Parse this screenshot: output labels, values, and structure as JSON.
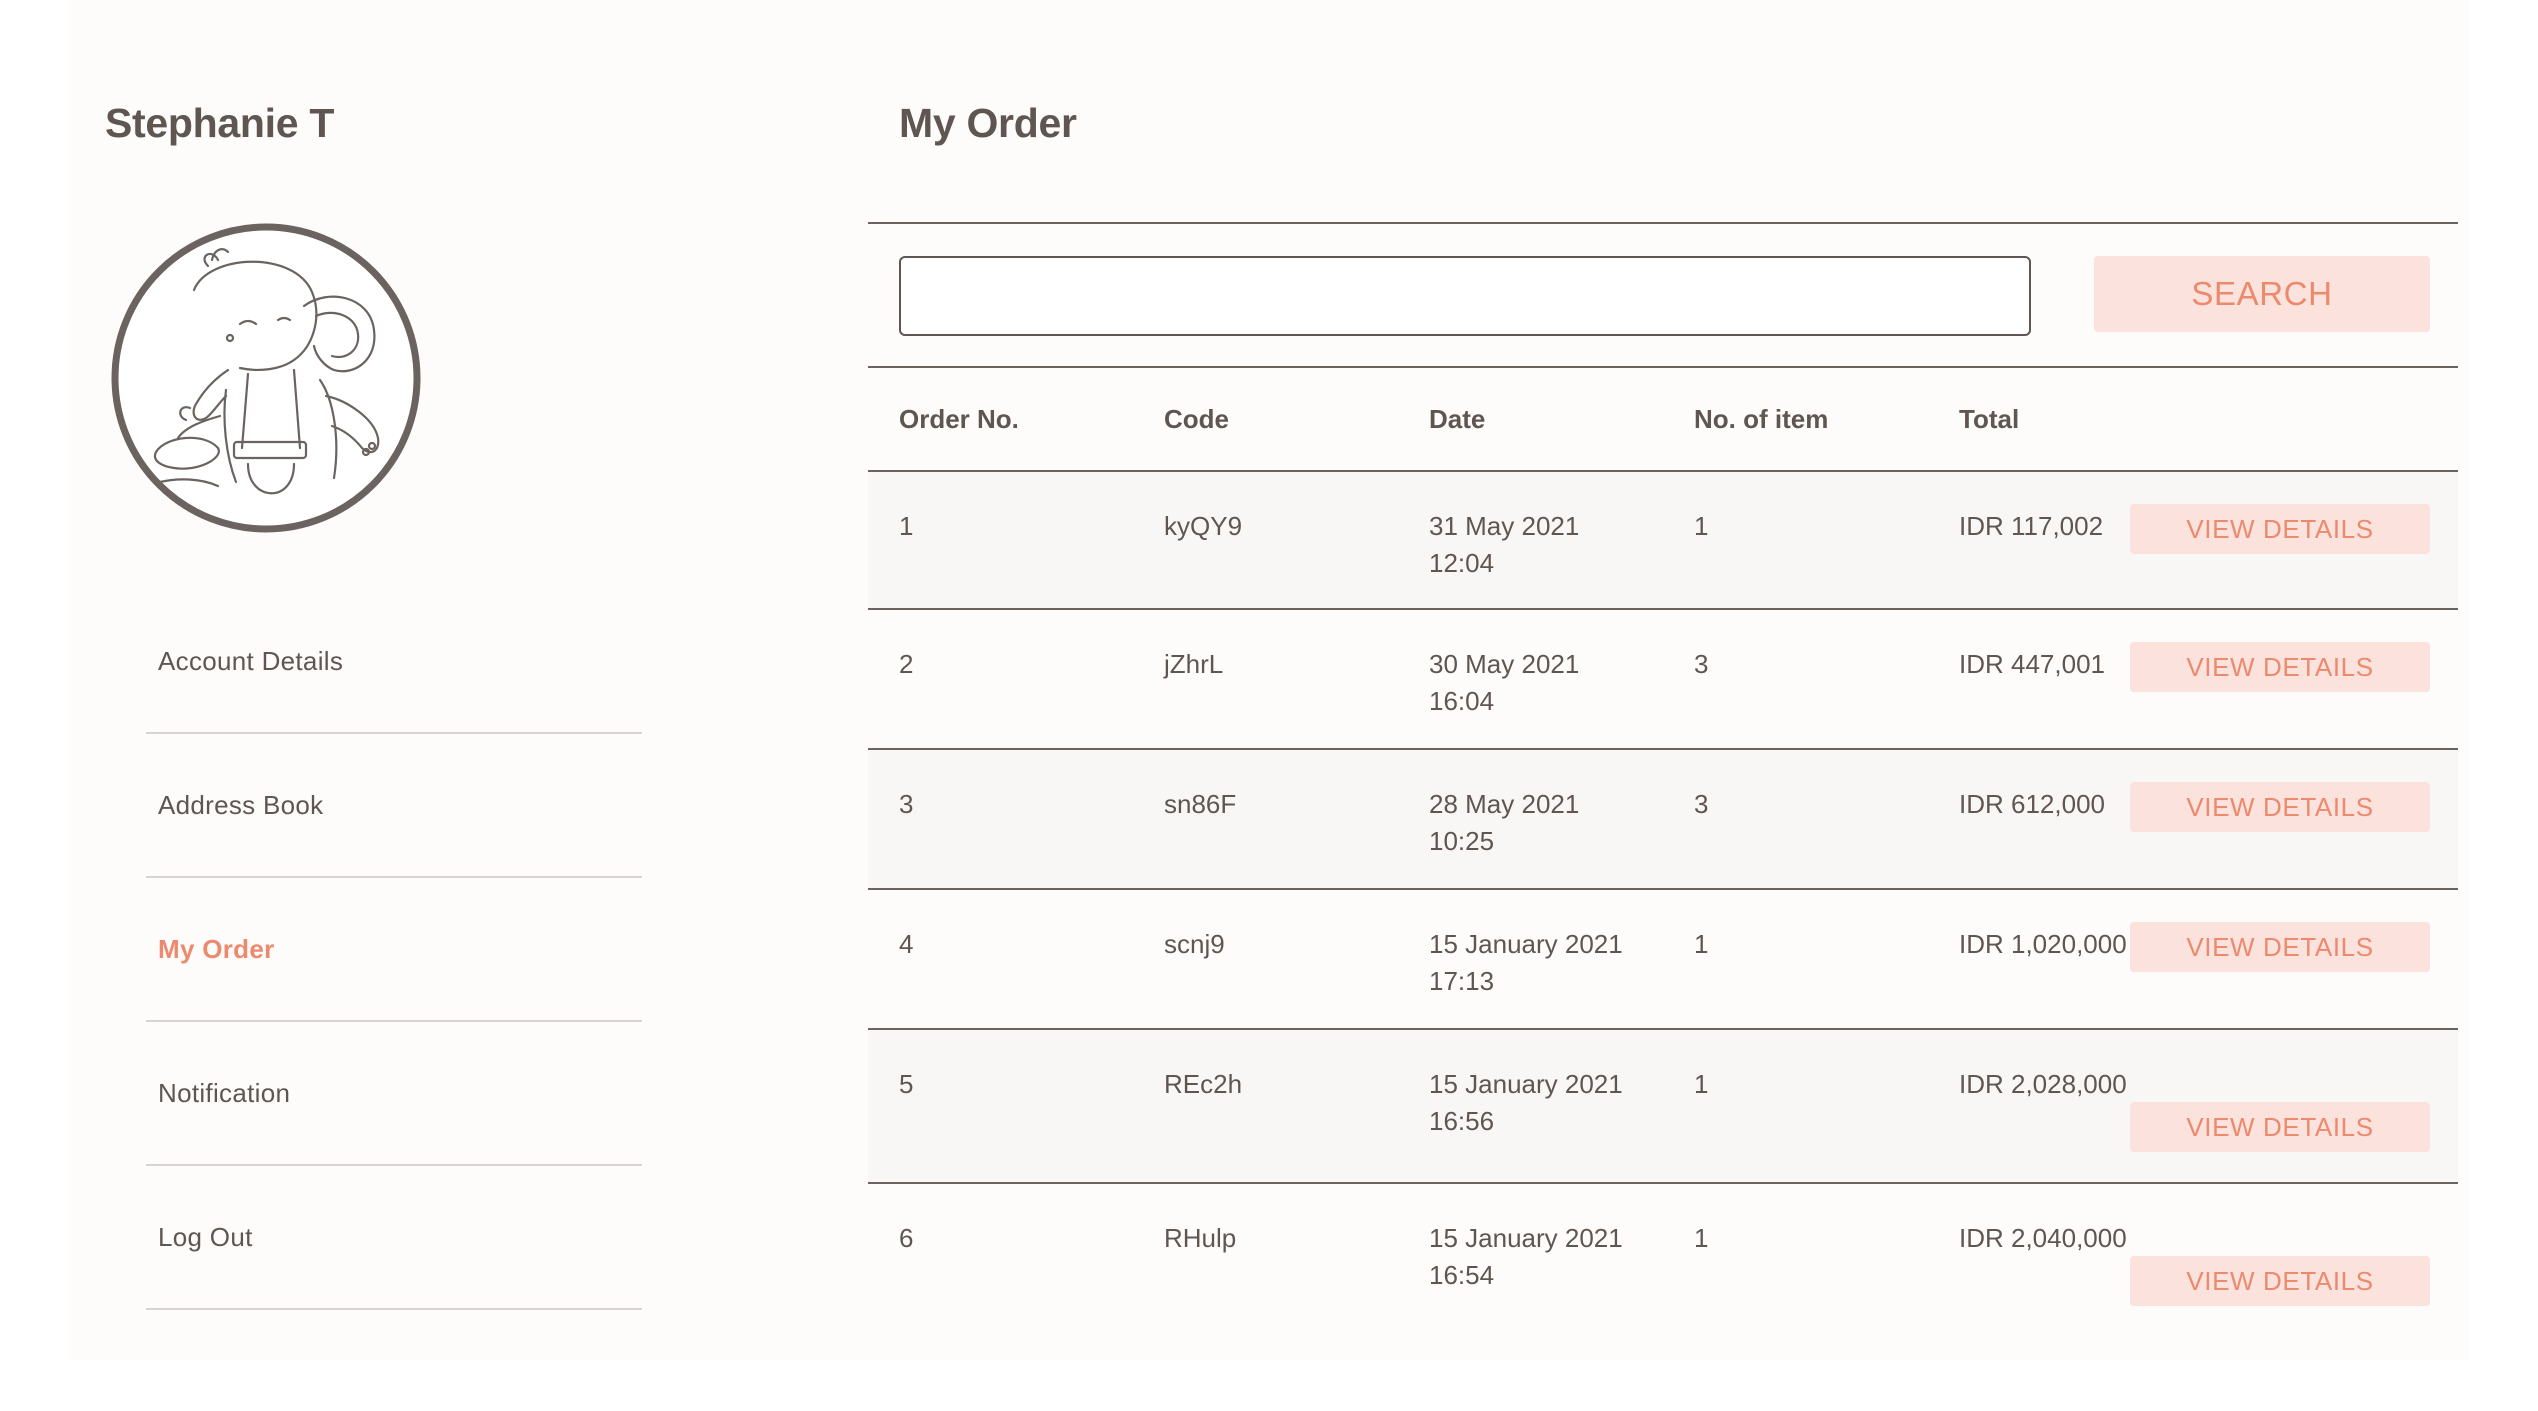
{
  "user": {
    "name": "Stephanie T"
  },
  "sidebar": {
    "items": [
      {
        "label": "Account Details",
        "active": false
      },
      {
        "label": "Address Book",
        "active": false
      },
      {
        "label": "My Order",
        "active": true
      },
      {
        "label": "Notification",
        "active": false
      },
      {
        "label": "Log Out",
        "active": false
      }
    ]
  },
  "main": {
    "title": "My Order",
    "search": {
      "value": "",
      "placeholder": "",
      "button_label": "SEARCH"
    },
    "table": {
      "headers": [
        "Order No.",
        "Code",
        "Date",
        "No. of item",
        "Total"
      ],
      "rows": [
        {
          "order_no": "1",
          "code": "kyQY9",
          "date": "31 May 2021",
          "time": "12:04",
          "items": "1",
          "total": "IDR 117,002",
          "action": "VIEW DETAILS"
        },
        {
          "order_no": "2",
          "code": "jZhrL",
          "date": "30 May 2021",
          "time": "16:04",
          "items": "3",
          "total": "IDR 447,001",
          "action": "VIEW DETAILS"
        },
        {
          "order_no": "3",
          "code": "sn86F",
          "date": "28 May 2021",
          "time": "10:25",
          "items": "3",
          "total": "IDR 612,000",
          "action": "VIEW DETAILS"
        },
        {
          "order_no": "4",
          "code": "scnj9",
          "date": "15 January 2021",
          "time": "17:13",
          "items": "1",
          "total": "IDR 1,020,000",
          "action": "VIEW DETAILS"
        },
        {
          "order_no": "5",
          "code": "REc2h",
          "date": "15 January 2021",
          "time": "16:56",
          "items": "1",
          "total": "IDR 2,028,000",
          "action": "VIEW DETAILS"
        },
        {
          "order_no": "6",
          "code": "RHulp",
          "date": "15 January 2021",
          "time": "16:54",
          "items": "1",
          "total": "IDR 2,040,000",
          "action": "VIEW DETAILS"
        }
      ]
    }
  },
  "colors": {
    "text": "#5f5651",
    "accent": "#ec8a6e",
    "button_bg": "#fbe2dc",
    "rule": "#6b635f"
  }
}
